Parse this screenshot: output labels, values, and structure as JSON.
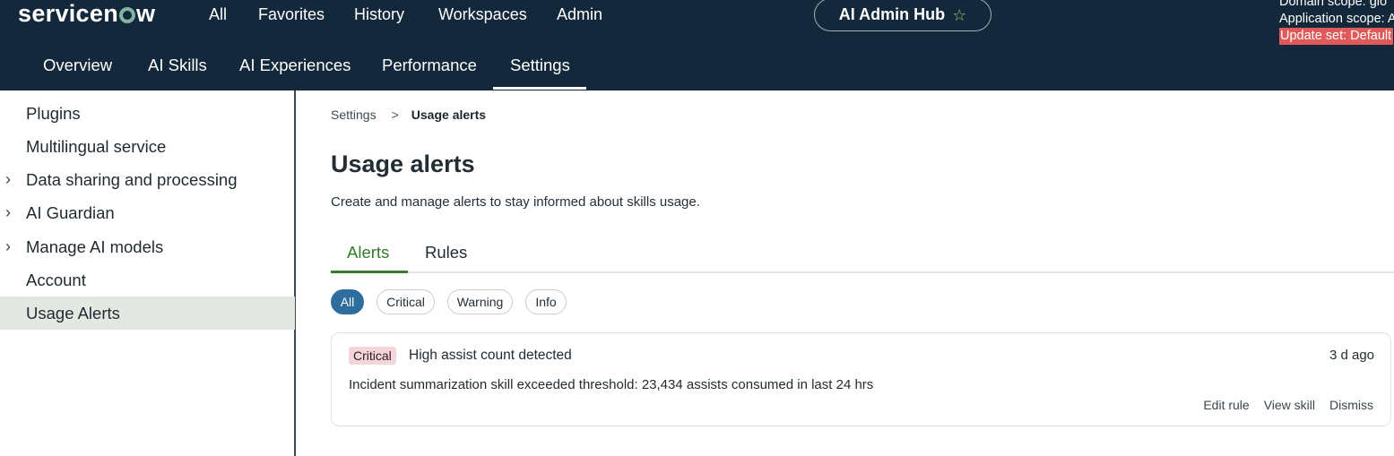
{
  "topbar": {
    "logo": {
      "prefix": "servicen",
      "mark": "o",
      "suffix": "w"
    },
    "nav": [
      "All",
      "Favorites",
      "History",
      "Workspaces",
      "Admin"
    ],
    "hub": {
      "label": "AI Admin Hub",
      "star_icon": "star-icon"
    },
    "scope": {
      "domain": "Domain scope: glo",
      "application": "Application scope: A",
      "update_set": "Update set: Default"
    },
    "subnav": [
      "Overview",
      "AI Skills",
      "AI Experiences",
      "Performance",
      "Settings"
    ],
    "active_subnav": "Settings"
  },
  "sidebar": {
    "items": [
      {
        "label": "Plugins",
        "expandable": false
      },
      {
        "label": "Multilingual service",
        "expandable": false
      },
      {
        "label": "Data sharing and processing",
        "expandable": true
      },
      {
        "label": "AI Guardian",
        "expandable": true
      },
      {
        "label": "Manage AI models",
        "expandable": true
      },
      {
        "label": "Account",
        "expandable": false
      },
      {
        "label": "Usage Alerts",
        "expandable": false,
        "active": true
      }
    ]
  },
  "main": {
    "breadcrumb": {
      "parent": "Settings",
      "separator": ">",
      "current": "Usage alerts"
    },
    "title": "Usage alerts",
    "description": "Create and manage alerts to stay informed about skills usage.",
    "tabs": [
      "Alerts",
      "Rules"
    ],
    "active_tab": "Alerts",
    "filters": [
      "All",
      "Critical",
      "Warning",
      "Info"
    ],
    "active_filter": "All",
    "alerts": [
      {
        "severity": "Critical",
        "title": "High assist count detected",
        "time": "3 d ago",
        "body": "Incident summarization skill exceeded threshold: 23,434 assists consumed in last 24 hrs",
        "actions": [
          "Edit rule",
          "View skill",
          "Dismiss"
        ]
      }
    ]
  },
  "colors": {
    "topbar_bg": "#13293b",
    "active_tab": "#35792b",
    "active_chip": "#2d6e9e",
    "critical_badge": "#f4d6da",
    "update_set_bg": "#e05a5a",
    "star": "#8cc66a"
  }
}
